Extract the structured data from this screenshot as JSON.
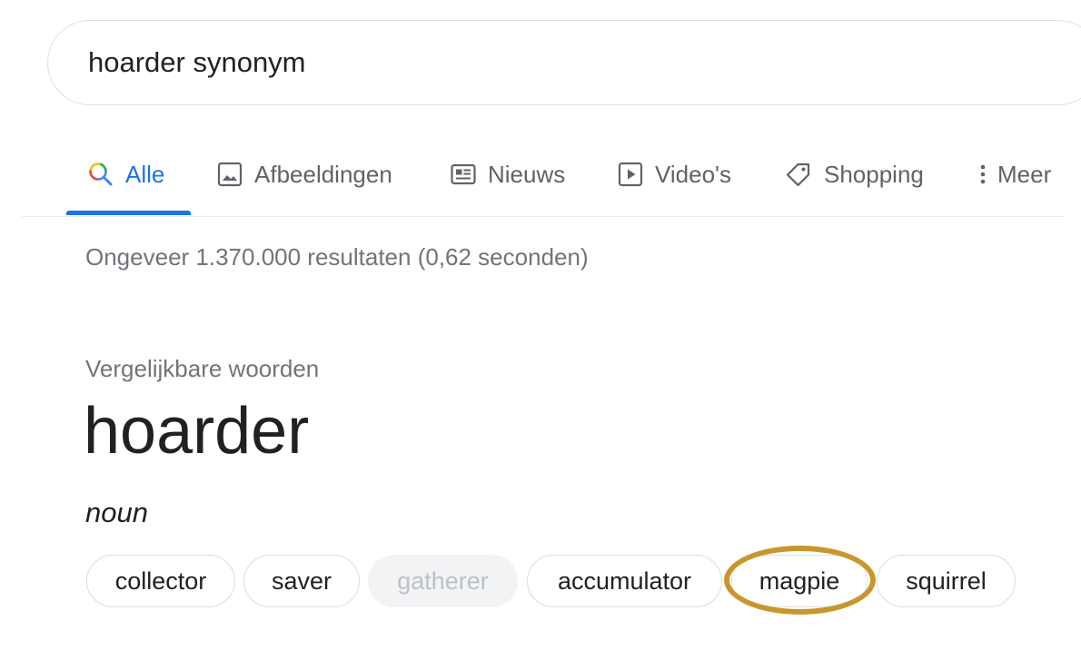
{
  "search": {
    "query": "hoarder synonym"
  },
  "tabs": [
    {
      "label": "Alle",
      "icon": "search-icon",
      "active": true
    },
    {
      "label": "Afbeeldingen",
      "icon": "image-icon",
      "active": false
    },
    {
      "label": "Nieuws",
      "icon": "news-icon",
      "active": false
    },
    {
      "label": "Video's",
      "icon": "video-icon",
      "active": false
    },
    {
      "label": "Shopping",
      "icon": "tag-icon",
      "active": false
    },
    {
      "label": "Meer",
      "icon": "more-vert-icon",
      "active": false
    }
  ],
  "result_stats": "Ongeveer 1.370.000 resultaten (0,62 seconden)",
  "synonyms": {
    "section_label": "Vergelijkbare woorden",
    "headword": "hoarder",
    "part_of_speech": "noun",
    "chips": [
      {
        "label": "collector",
        "disabled": false
      },
      {
        "label": "saver",
        "disabled": false
      },
      {
        "label": "gatherer",
        "disabled": true
      },
      {
        "label": "accumulator",
        "disabled": false
      },
      {
        "label": "magpie",
        "disabled": false,
        "highlighted": true
      },
      {
        "label": "squirrel",
        "disabled": false
      }
    ]
  },
  "colors": {
    "accent": "#1a73e8",
    "highlight": "#c9962e",
    "muted_text": "#70757a"
  }
}
